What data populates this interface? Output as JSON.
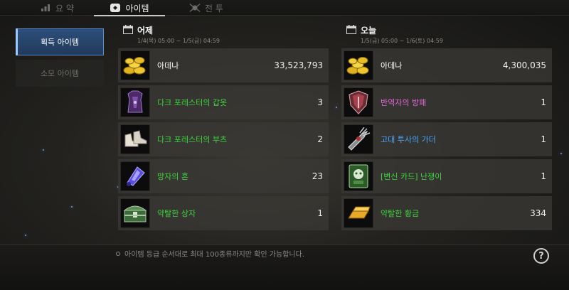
{
  "tabs": [
    {
      "label": "요 약",
      "icon": "chart-icon",
      "active": false
    },
    {
      "label": "아이템",
      "icon": "bag-icon",
      "active": true
    },
    {
      "label": "전 투",
      "icon": "battle-icon",
      "active": false
    }
  ],
  "sidebar": {
    "items": [
      {
        "label": "획득 아이템",
        "active": true
      },
      {
        "label": "소모 아이템",
        "active": false
      }
    ]
  },
  "yesterday": {
    "title": "어제",
    "range": "1/4(목) 05:00 ~ 1/5(금) 04:59",
    "items": [
      {
        "name": "아데나",
        "count": "33,523,793",
        "color": "#ffffff",
        "icon": "adena-coins-icon"
      },
      {
        "name": "다크 포레스터의 갑옷",
        "count": "3",
        "color": "#3fd43f",
        "icon": "dark-armor-icon"
      },
      {
        "name": "다크 포레스터의 부츠",
        "count": "2",
        "color": "#3fd43f",
        "icon": "boots-icon"
      },
      {
        "name": "망자의 혼",
        "count": "23",
        "color": "#3fd43f",
        "icon": "soul-crystal-icon"
      },
      {
        "name": "약탈한 상자",
        "count": "1",
        "color": "#3fd43f",
        "icon": "chest-icon"
      }
    ]
  },
  "today": {
    "title": "오늘",
    "range": "1/5(금) 05:00 ~ 1/6(토) 04:59",
    "items": [
      {
        "name": "아데나",
        "count": "4,300,035",
        "color": "#ffffff",
        "icon": "adena-coins-icon"
      },
      {
        "name": "반역자의 방패",
        "count": "1",
        "color": "#e06ad8",
        "icon": "shield-icon"
      },
      {
        "name": "고대 투사의 가더",
        "count": "1",
        "color": "#4aa8ff",
        "icon": "guarder-icon"
      },
      {
        "name": "[변신 카드] 난쟁이",
        "count": "1",
        "color": "#3fd43f",
        "icon": "transform-card-icon"
      },
      {
        "name": "약탈한 황금",
        "count": "334",
        "color": "#3fd43f",
        "icon": "gold-bar-icon"
      }
    ]
  },
  "footer": {
    "notice": "아이템 등급 순서대로 최대 100종류까지만 확인 가능합니다.",
    "help_label": "?"
  }
}
